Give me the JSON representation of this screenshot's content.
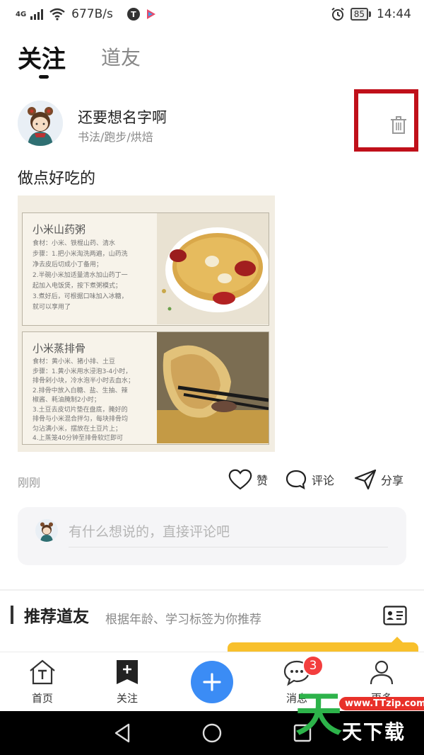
{
  "status_bar": {
    "network": "4G",
    "speed": "677B/s",
    "app_icon_letter": "T",
    "battery": "85",
    "time": "14:44"
  },
  "header": {
    "tabs": [
      {
        "label": "关注",
        "active": true
      },
      {
        "label": "道友",
        "active": false
      }
    ]
  },
  "post": {
    "username": "还要想名字啊",
    "tags": "书法/跑步/烘焙",
    "text": "做点好吃的",
    "image": {
      "recipes": [
        {
          "title": "小米山药粥",
          "lines": [
            "食材：小米、铁棍山药、清水",
            "步骤：1.把小米淘洗两遍，山药洗",
            "净去皮后切成小丁备用；",
            "2.半碗小米加适量清水加山药丁一",
            "起加入电饭煲，按下煮粥模式；",
            "3.煮好后，可根据口味加入冰糖，",
            "就可以享用了"
          ]
        },
        {
          "title": "小米蒸排骨",
          "lines": [
            "食材：黄小米、猪小排、土豆",
            "步骤：1.黄小米用水浸泡3-4小时，",
            "排骨剁小块，冷水泡半小时去血水；",
            "2.排骨中放入白糖、盐、生抽、辣",
            "椒酱、耗油腌制2小时；",
            "3.土豆去皮切片垫在盘底，腌好的",
            "排骨与小米混合拌匀，每块排骨均",
            "匀沾满小米，摆放在土豆片上；",
            "4.上蒸笼40分钟至排骨软烂即可"
          ]
        }
      ]
    },
    "time": "刚刚",
    "actions": {
      "like": "赞",
      "comment": "评论",
      "share": "分享"
    },
    "comment_placeholder": "有什么想说的，直接评论吧"
  },
  "recommend": {
    "title": "推荐道友",
    "subtitle": "根据年龄、学习标签为你推荐"
  },
  "bottom_nav": {
    "items": [
      {
        "label": "首页"
      },
      {
        "label": "关注"
      },
      {
        "label": "消息",
        "badge": "3"
      },
      {
        "label": "更多"
      }
    ]
  },
  "watermark": {
    "url": "www.TTzip.com",
    "big_char": "天",
    "text": "天下载"
  },
  "colors": {
    "accent_blue": "#3b8cf5",
    "highlight_red": "#c0101a",
    "badge_red": "#f33e3e",
    "tip_yellow": "#f8c02c"
  }
}
